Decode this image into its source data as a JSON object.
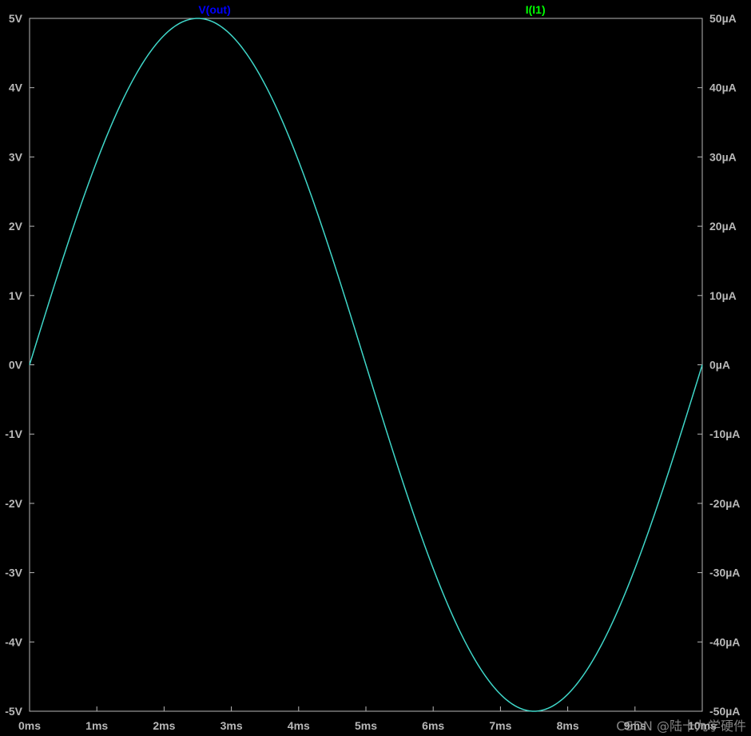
{
  "chart_data": {
    "type": "line",
    "series": [
      {
        "name": "V(out)",
        "axis": "left",
        "color": "#0000ff"
      },
      {
        "name": "I(I1)",
        "axis": "right",
        "color": "#00ff00"
      }
    ],
    "function": "sine",
    "x_unit": "ms",
    "xlim": [
      0,
      10
    ],
    "ylim_left": [
      -5,
      5
    ],
    "ylim_right": [
      -50,
      50
    ],
    "x_ticks": [
      "0ms",
      "1ms",
      "2ms",
      "3ms",
      "4ms",
      "5ms",
      "6ms",
      "7ms",
      "8ms",
      "9ms",
      "10ms"
    ],
    "y_ticks_left": [
      "5V",
      "4V",
      "3V",
      "2V",
      "1V",
      "0V",
      "-1V",
      "-2V",
      "-3V",
      "-4V",
      "-5V"
    ],
    "y_ticks_right": [
      "50µA",
      "40µA",
      "30µA",
      "20µA",
      "10µA",
      "0µA",
      "-10µA",
      "-20µA",
      "-30µA",
      "-40µA",
      "-50µA"
    ],
    "samples_x": [
      0,
      0.5,
      1,
      1.5,
      2,
      2.5,
      3,
      3.5,
      4,
      4.5,
      5,
      5.5,
      6,
      6.5,
      7,
      7.5,
      8,
      8.5,
      9,
      9.5,
      10
    ],
    "samples_v": [
      0,
      1.56,
      2.94,
      4.05,
      4.76,
      5,
      4.76,
      4.05,
      2.94,
      1.56,
      0,
      -1.56,
      -2.94,
      -4.05,
      -4.76,
      -5,
      -4.76,
      -4.05,
      -2.94,
      -1.56,
      0
    ],
    "grid": false,
    "background": "#000000",
    "axis_color": "#b8b8b8",
    "trace_color": "#3fd7c9"
  },
  "watermark": "CSDN @陆十九学硬件"
}
